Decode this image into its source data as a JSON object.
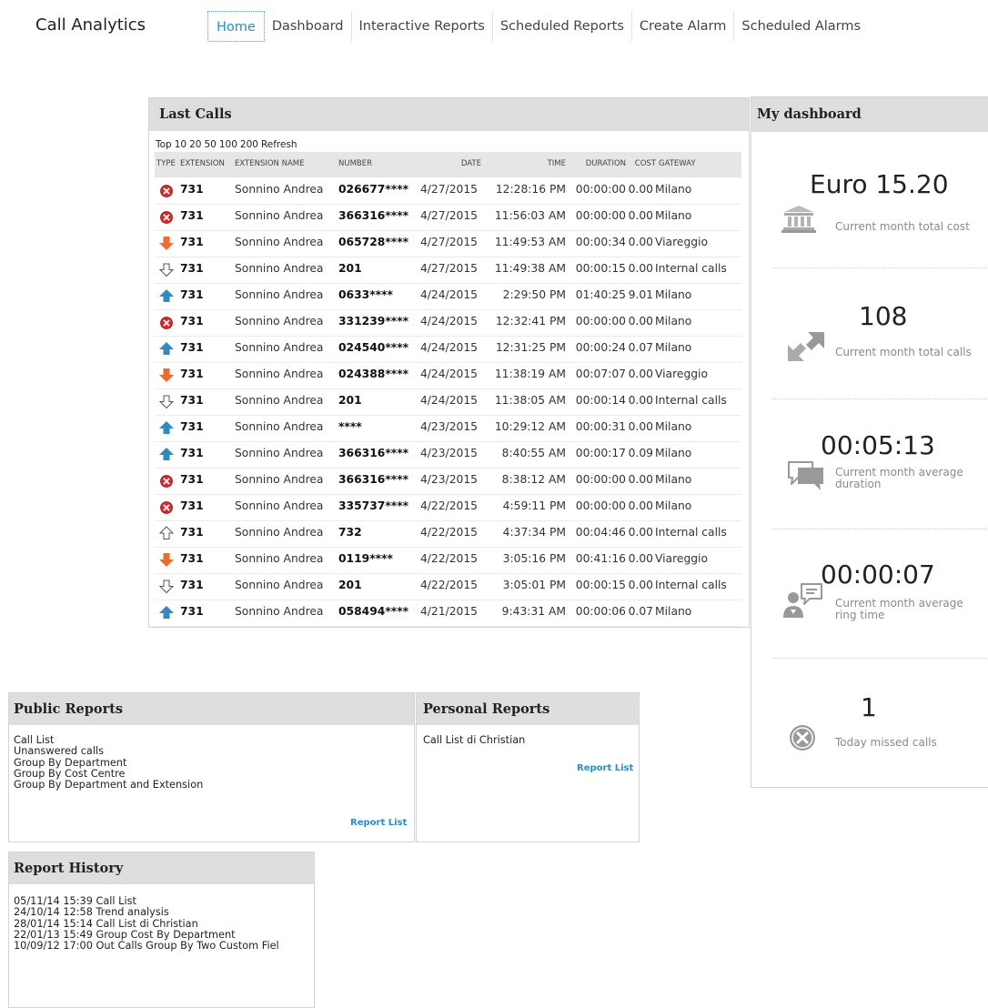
{
  "app": {
    "title": "Call Analytics"
  },
  "nav": {
    "tabs": [
      {
        "label": "Home",
        "active": true
      },
      {
        "label": "Dashboard"
      },
      {
        "label": "Interactive Reports"
      },
      {
        "label": "Scheduled Reports"
      },
      {
        "label": "Create Alarm"
      },
      {
        "label": "Scheduled Alarms"
      }
    ]
  },
  "last_calls": {
    "title": "Last Calls",
    "top_label": "Top",
    "top_options": [
      "10",
      "20",
      "50",
      "100",
      "200"
    ],
    "refresh_label": "Refresh",
    "columns": [
      "TYPE",
      "EXTENSION",
      "EXTENSION NAME",
      "NUMBER",
      "DATE",
      "TIME",
      "DURATION",
      "COST",
      "GATEWAY"
    ],
    "rows": [
      {
        "type": "missed",
        "extension": "731",
        "name": "Sonnino Andrea",
        "number": "026677****",
        "date": "4/27/2015",
        "time": "12:28:16 PM",
        "duration": "00:00:00",
        "cost": "0.00",
        "gateway": "Milano"
      },
      {
        "type": "missed",
        "extension": "731",
        "name": "Sonnino Andrea",
        "number": "366316****",
        "date": "4/27/2015",
        "time": "11:56:03 AM",
        "duration": "00:00:00",
        "cost": "0.00",
        "gateway": "Milano"
      },
      {
        "type": "incoming",
        "extension": "731",
        "name": "Sonnino Andrea",
        "number": "065728****",
        "date": "4/27/2015",
        "time": "11:49:53 AM",
        "duration": "00:00:34",
        "cost": "0.00",
        "gateway": "Viareggio"
      },
      {
        "type": "internal-in",
        "extension": "731",
        "name": "Sonnino Andrea",
        "number": "201",
        "date": "4/27/2015",
        "time": "11:49:38 AM",
        "duration": "00:00:15",
        "cost": "0.00",
        "gateway": "Internal calls"
      },
      {
        "type": "outgoing",
        "extension": "731",
        "name": "Sonnino Andrea",
        "number": "0633****",
        "date": "4/24/2015",
        "time": "2:29:50 PM",
        "duration": "01:40:25",
        "cost": "9.01",
        "gateway": "Milano"
      },
      {
        "type": "missed",
        "extension": "731",
        "name": "Sonnino Andrea",
        "number": "331239****",
        "date": "4/24/2015",
        "time": "12:32:41 PM",
        "duration": "00:00:00",
        "cost": "0.00",
        "gateway": "Milano"
      },
      {
        "type": "outgoing",
        "extension": "731",
        "name": "Sonnino Andrea",
        "number": "024540****",
        "date": "4/24/2015",
        "time": "12:31:25 PM",
        "duration": "00:00:24",
        "cost": "0.07",
        "gateway": "Milano"
      },
      {
        "type": "incoming",
        "extension": "731",
        "name": "Sonnino Andrea",
        "number": "024388****",
        "date": "4/24/2015",
        "time": "11:38:19 AM",
        "duration": "00:07:07",
        "cost": "0.00",
        "gateway": "Viareggio"
      },
      {
        "type": "internal-in",
        "extension": "731",
        "name": "Sonnino Andrea",
        "number": "201",
        "date": "4/24/2015",
        "time": "11:38:05 AM",
        "duration": "00:00:14",
        "cost": "0.00",
        "gateway": "Internal calls"
      },
      {
        "type": "outgoing",
        "extension": "731",
        "name": "Sonnino Andrea",
        "number": "****",
        "date": "4/23/2015",
        "time": "10:29:12 AM",
        "duration": "00:00:31",
        "cost": "0.00",
        "gateway": "Milano"
      },
      {
        "type": "outgoing",
        "extension": "731",
        "name": "Sonnino Andrea",
        "number": "366316****",
        "date": "4/23/2015",
        "time": "8:40:55 AM",
        "duration": "00:00:17",
        "cost": "0.09",
        "gateway": "Milano"
      },
      {
        "type": "missed",
        "extension": "731",
        "name": "Sonnino Andrea",
        "number": "366316****",
        "date": "4/23/2015",
        "time": "8:38:12 AM",
        "duration": "00:00:00",
        "cost": "0.00",
        "gateway": "Milano"
      },
      {
        "type": "missed",
        "extension": "731",
        "name": "Sonnino Andrea",
        "number": "335737****",
        "date": "4/22/2015",
        "time": "4:59:11 PM",
        "duration": "00:00:00",
        "cost": "0.00",
        "gateway": "Milano"
      },
      {
        "type": "internal-out",
        "extension": "731",
        "name": "Sonnino Andrea",
        "number": "732",
        "date": "4/22/2015",
        "time": "4:37:34 PM",
        "duration": "00:04:46",
        "cost": "0.00",
        "gateway": "Internal calls"
      },
      {
        "type": "incoming",
        "extension": "731",
        "name": "Sonnino Andrea",
        "number": "0119****",
        "date": "4/22/2015",
        "time": "3:05:16 PM",
        "duration": "00:41:16",
        "cost": "0.00",
        "gateway": "Viareggio"
      },
      {
        "type": "internal-in",
        "extension": "731",
        "name": "Sonnino Andrea",
        "number": "201",
        "date": "4/22/2015",
        "time": "3:05:01 PM",
        "duration": "00:00:15",
        "cost": "0.00",
        "gateway": "Internal calls"
      },
      {
        "type": "outgoing",
        "extension": "731",
        "name": "Sonnino Andrea",
        "number": "058494****",
        "date": "4/21/2015",
        "time": "9:43:31 AM",
        "duration": "00:00:06",
        "cost": "0.07",
        "gateway": "Milano"
      }
    ]
  },
  "dashboard": {
    "title": "My dashboard",
    "metrics": [
      {
        "value": "Euro 15.20",
        "label": "Current month total cost",
        "icon": "bank-icon"
      },
      {
        "value": "108",
        "label": "Current month total calls",
        "icon": "arrows-icon"
      },
      {
        "value": "00:05:13",
        "label": "Current month average duration",
        "icon": "chat-icon"
      },
      {
        "value": "00:00:07",
        "label": "Current month average ring time",
        "icon": "user-chat-icon"
      },
      {
        "value": "1",
        "label": "Today missed calls",
        "icon": "missed-circle-icon"
      }
    ]
  },
  "public_reports": {
    "title": "Public Reports",
    "items": [
      "Call List",
      "Unanswered calls",
      "Group By Department",
      "Group By Cost Centre",
      "Group By Department and Extension"
    ],
    "link": "Report List"
  },
  "personal_reports": {
    "title": "Personal Reports",
    "items": [
      "Call List di Christian"
    ],
    "link": "Report List"
  },
  "report_history": {
    "title": "Report History",
    "items": [
      {
        "ts": "05/11/14 15:39",
        "name": "Call List"
      },
      {
        "ts": "24/10/14 12:58",
        "name": "Trend analysis"
      },
      {
        "ts": "28/01/14 15:14",
        "name": "Call List di Christian"
      },
      {
        "ts": "22/01/13 15:49",
        "name": "Group Cost By Department"
      },
      {
        "ts": "10/09/12 17:00",
        "name": "Out Calls Group By Two Custom Fiel"
      }
    ]
  },
  "colors": {
    "accent": "#2a8dc8",
    "missed": "#d8282b",
    "incoming": "#f26a2a",
    "outgoing": "#2f8ac4"
  }
}
